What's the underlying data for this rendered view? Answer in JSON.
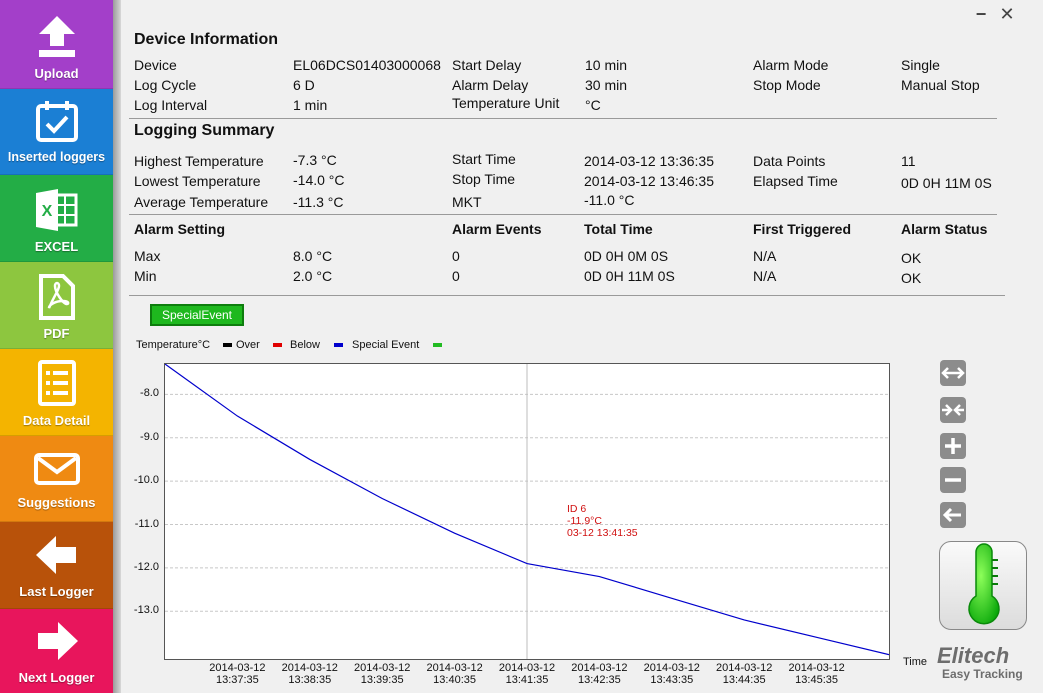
{
  "sidebar": {
    "items": [
      {
        "label": "Upload",
        "icon": "upload-arrow-icon",
        "color": "#a33fc9"
      },
      {
        "label": "Inserted loggers",
        "icon": "calendar-check-icon",
        "color": "#1b7fd4"
      },
      {
        "label": "EXCEL",
        "icon": "excel-icon",
        "color": "#23ad46"
      },
      {
        "label": "PDF",
        "icon": "pdf-icon",
        "color": "#8dc63f"
      },
      {
        "label": "Data Detail",
        "icon": "list-icon",
        "color": "#f4b400"
      },
      {
        "label": "Suggestions",
        "icon": "envelope-icon",
        "color": "#ef8a12"
      },
      {
        "label": "Last Logger",
        "icon": "arrow-left-icon",
        "color": "#b8520a"
      },
      {
        "label": "Next Logger",
        "icon": "arrow-right-icon",
        "color": "#e8155c"
      }
    ]
  },
  "window": {
    "minimize": "−",
    "close": "✕"
  },
  "device_info": {
    "title": "Device Information",
    "device_label": "Device",
    "device_value": "EL06DCS01403000068",
    "log_cycle_label": "Log Cycle",
    "log_cycle_value": "6 D",
    "log_interval_label": "Log Interval",
    "log_interval_value": "1 min",
    "start_delay_label": "Start Delay",
    "start_delay_value": "10 min",
    "alarm_delay_label": "Alarm Delay",
    "alarm_delay_value": "30 min",
    "temp_unit_label": "Temperature Unit",
    "temp_unit_value": "°C",
    "alarm_mode_label": "Alarm Mode",
    "alarm_mode_value": "Single",
    "stop_mode_label": "Stop Mode",
    "stop_mode_value": "Manual Stop"
  },
  "logging_summary": {
    "title": "Logging Summary",
    "highest_label": "Highest Temperature",
    "highest_value": "-7.3 °C",
    "lowest_label": "Lowest Temperature",
    "lowest_value": "-14.0 °C",
    "average_label": "Average Temperature",
    "average_value": "-11.3 °C",
    "start_time_label": "Start Time",
    "start_time_value": "2014-03-12 13:36:35",
    "stop_time_label": "Stop Time",
    "stop_time_value": "2014-03-12 13:46:35",
    "mkt_label": "MKT",
    "mkt_value": "-11.0 °C",
    "data_points_label": "Data Points",
    "data_points_value": "11",
    "elapsed_label": "Elapsed Time",
    "elapsed_value": "0D 0H 11M 0S"
  },
  "alarm_table": {
    "headers": [
      "Alarm Setting",
      "Alarm Events",
      "Total Time",
      "First Triggered",
      "Alarm Status"
    ],
    "rows": [
      [
        "Max",
        "8.0 °C",
        "0",
        "0D 0H 0M 0S",
        "N/A",
        "OK"
      ],
      [
        "Min",
        "2.0 °C",
        "0",
        "0D 0H 11M 0S",
        "N/A",
        "OK"
      ]
    ]
  },
  "special_event_button": "SpecialEvent",
  "legend": {
    "unit": "Temperature°C",
    "items": [
      {
        "label": "Over",
        "color": "#000000"
      },
      {
        "label": "Below",
        "color": "#e00000"
      },
      {
        "label": "Special Event",
        "color": "#0000cc"
      },
      {
        "label": "",
        "color": "#22bb22"
      }
    ]
  },
  "tooltip": {
    "line1": "ID 6",
    "line2": "-11.9°C",
    "line3": "03-12 13:41:35"
  },
  "chart_data": {
    "type": "line",
    "xlabel": "Time",
    "ylabel": "Temperature°C",
    "x": [
      "2014-03-12 13:36:35",
      "2014-03-12 13:37:35",
      "2014-03-12 13:38:35",
      "2014-03-12 13:39:35",
      "2014-03-12 13:40:35",
      "2014-03-12 13:41:35",
      "2014-03-12 13:42:35",
      "2014-03-12 13:43:35",
      "2014-03-12 13:44:35",
      "2014-03-12 13:45:35",
      "2014-03-12 13:46:35"
    ],
    "series": [
      {
        "values": [
          -7.3,
          -8.5,
          -9.5,
          -10.4,
          -11.2,
          -11.9,
          -12.2,
          -12.7,
          -13.2,
          -13.6,
          -14.0
        ],
        "color": "#0000cc"
      }
    ],
    "yticks": [
      "-8.0",
      "-9.0",
      "-10.0",
      "-11.0",
      "-12.0",
      "-13.0"
    ],
    "xticks": [
      [
        "2014-03-12",
        "13:37:35"
      ],
      [
        "2014-03-12",
        "13:38:35"
      ],
      [
        "2014-03-12",
        "13:39:35"
      ],
      [
        "2014-03-12",
        "13:40:35"
      ],
      [
        "2014-03-12",
        "13:41:35"
      ],
      [
        "2014-03-12",
        "13:42:35"
      ],
      [
        "2014-03-12",
        "13:43:35"
      ],
      [
        "2014-03-12",
        "13:44:35"
      ],
      [
        "2014-03-12",
        "13:45:35"
      ]
    ],
    "ylim": [
      -14.1,
      -7.3
    ],
    "grid": true,
    "cursor_index": 5
  },
  "branding": {
    "logo": "Elitech",
    "tagline": "Easy Tracking"
  },
  "tools": [
    "expand-horizontal-icon",
    "compress-horizontal-icon",
    "zoom-in-icon",
    "zoom-out-icon",
    "back-icon"
  ]
}
